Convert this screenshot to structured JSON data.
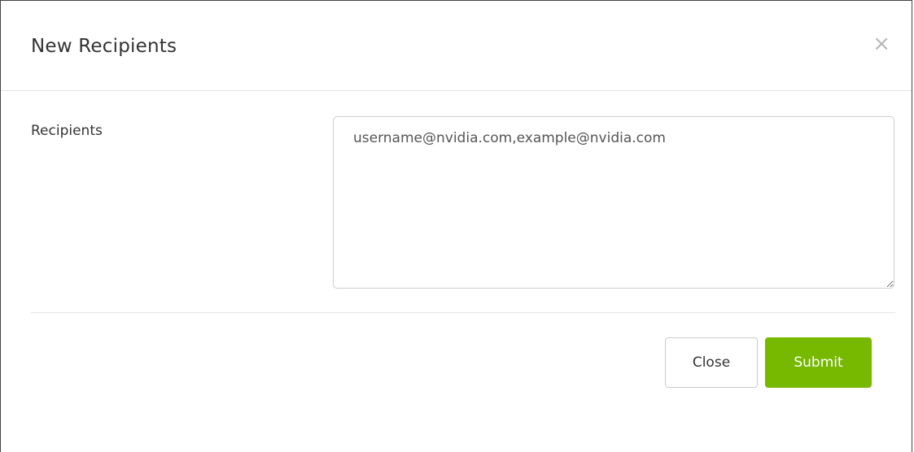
{
  "modal": {
    "title": "New Recipients",
    "close_glyph": "×"
  },
  "form": {
    "recipients_label": "Recipients",
    "recipients_value": "username@nvidia.com,example@nvidia.com"
  },
  "footer": {
    "close_label": "Close",
    "submit_label": "Submit"
  },
  "colors": {
    "accent": "#76b900",
    "border": "#cfcfcf",
    "divider": "#e5e5e5"
  }
}
